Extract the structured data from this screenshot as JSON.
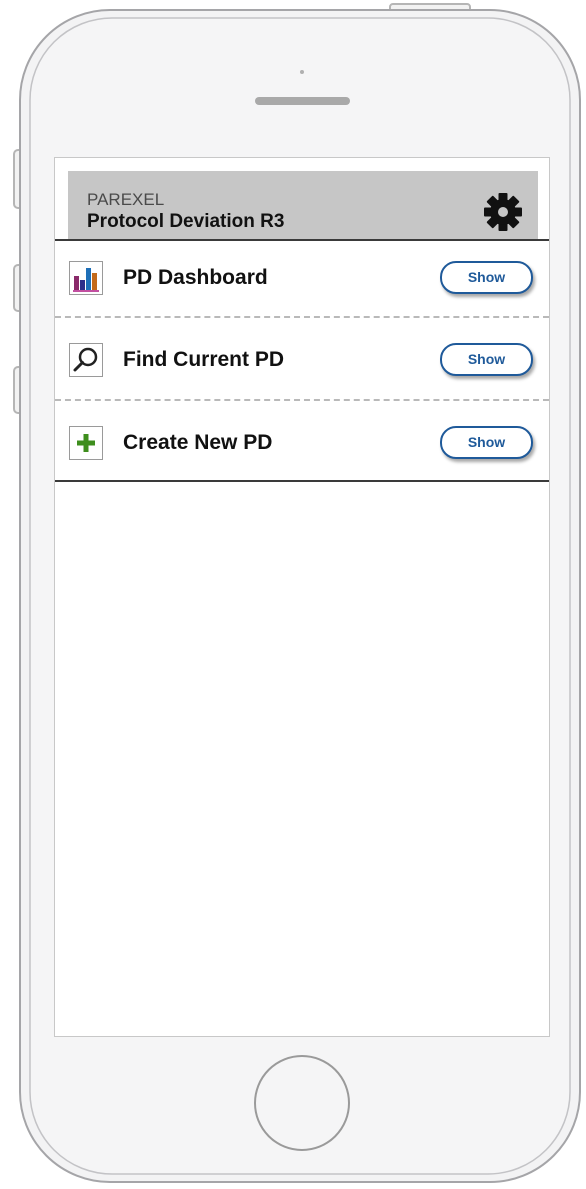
{
  "header": {
    "company": "PAREXEL",
    "title": "Protocol Deviation R3",
    "settings_icon": "gear-icon"
  },
  "menu": {
    "items": [
      {
        "label": "PD Dashboard",
        "icon": "bar-chart-icon",
        "button": "Show"
      },
      {
        "label": "Find Current PD",
        "icon": "magnifier-icon",
        "button": "Show"
      },
      {
        "label": "Create New PD",
        "icon": "plus-icon",
        "button": "Show"
      }
    ]
  },
  "colors": {
    "header_bg": "#c6c6c6",
    "button_border": "#1f5a9a",
    "plus_green": "#3e8e1d"
  }
}
